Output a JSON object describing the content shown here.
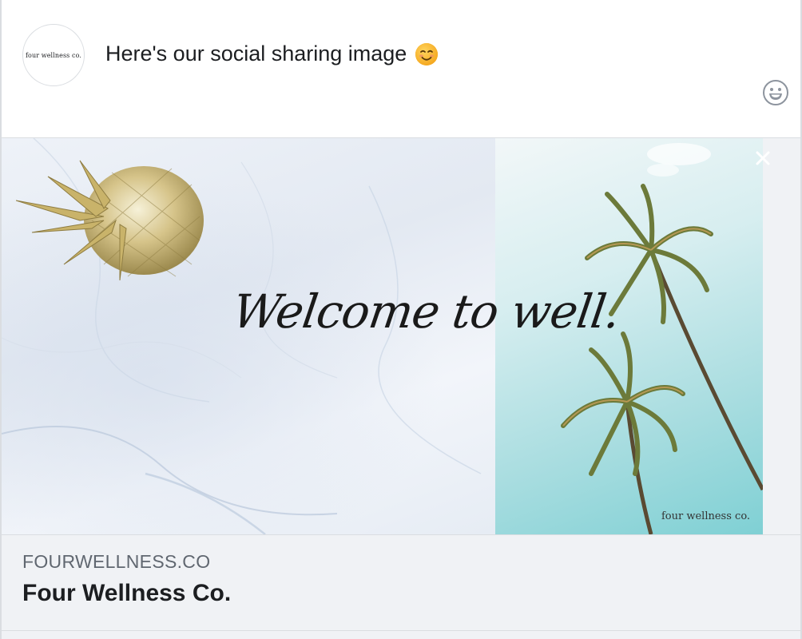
{
  "composer": {
    "avatar_text": "four wellness co.",
    "post_text": "Here's our social sharing image",
    "post_emoji": "smiling-face-icon",
    "emoji_button_icon": "smiley-icon"
  },
  "preview": {
    "image_headline": "Welcome to well.",
    "image_watermark": "four wellness co.",
    "close_icon": "close-icon",
    "domain": "FOURWELLNESS.CO",
    "title": "Four Wellness Co."
  },
  "colors": {
    "text_primary": "#1c1e21",
    "text_secondary": "#606770",
    "card_background": "#f0f2f5",
    "border": "#dadde1"
  }
}
